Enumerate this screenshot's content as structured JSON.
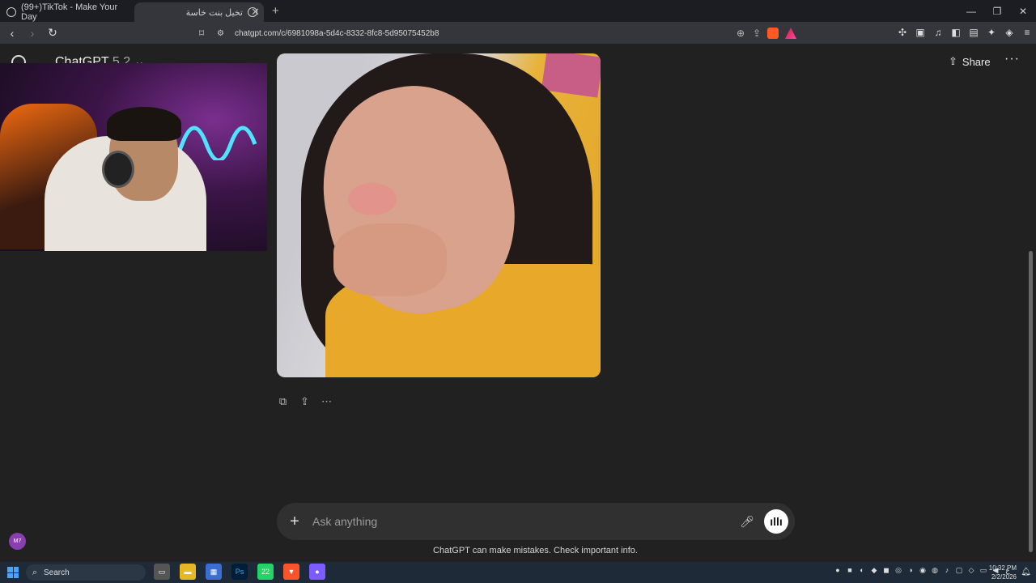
{
  "browser": {
    "tabs": [
      {
        "label": "(99+)TikTok - Make Your Day"
      },
      {
        "label": "تخيل بنت خاسة"
      }
    ],
    "url": "chatgpt.com/c/6981098a-5d4c-8332-8fc8-5d95075452b8"
  },
  "header": {
    "model_name": "ChatGPT",
    "model_version": "5.2",
    "share_label": "Share"
  },
  "composer": {
    "placeholder": "Ask anything"
  },
  "disclaimer": "ChatGPT can make mistakes. Check important info.",
  "avatar": {
    "initials": "M7"
  },
  "taskbar": {
    "search_label": "Search",
    "whatsapp_badge": "22",
    "time": "10:32 PM",
    "date": "2/2/2026",
    "lang": "ع"
  },
  "icons": [
    "back-icon",
    "forward-icon",
    "reload-icon",
    "bookmark-icon",
    "zoom-icon",
    "share-icon",
    "copy-icon",
    "upload-icon",
    "more-icon",
    "plus-icon",
    "mic-icon",
    "voice-icon"
  ],
  "colors": {
    "accent_orange": "#f06a10",
    "sweater": "#e8a82a"
  }
}
